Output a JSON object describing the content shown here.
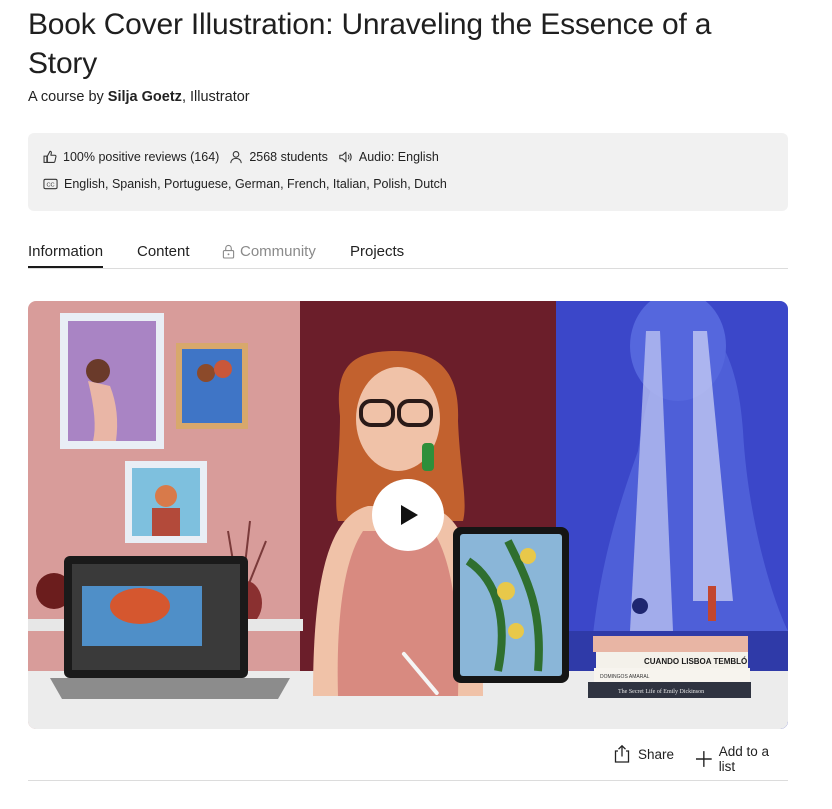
{
  "course": {
    "title": "Book Cover Illustration: Unraveling the Essence of a Story",
    "byline_prefix": "A course by ",
    "author": "Silja Goetz",
    "author_role": ", Illustrator"
  },
  "stats": {
    "reviews": "100% positive reviews (164)",
    "students": "2568 students",
    "audio": "Audio: English",
    "subtitles": "English, Spanish, Portuguese, German, French, Italian, Polish, Dutch"
  },
  "tabs": [
    {
      "label": "Information",
      "active": true
    },
    {
      "label": "Content"
    },
    {
      "label": "Community",
      "locked": true
    },
    {
      "label": "Projects"
    }
  ],
  "video": {
    "book_titles": [
      "CUANDO LISBOA TEMBLÓ",
      "DOMINGOS AMARAL",
      "The Secret Life of Emily Dickinson"
    ]
  },
  "actions": {
    "share": "Share",
    "add_to_list": "Add to a list"
  },
  "colors": {
    "accent": "#1a1a1a",
    "stats_bg": "#f1f1f1",
    "locked_text": "#8a8a8a"
  }
}
